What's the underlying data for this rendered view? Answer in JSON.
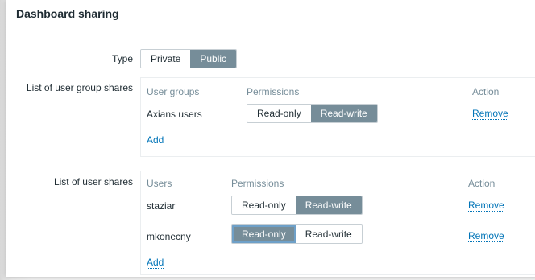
{
  "dialog": {
    "title": "Dashboard sharing"
  },
  "type_field": {
    "label": "Type",
    "options": [
      "Private",
      "Public"
    ],
    "selected": "Public"
  },
  "group_shares": {
    "label": "List of user group shares",
    "columns": {
      "name": "User groups",
      "permissions": "Permissions",
      "action": "Action"
    },
    "rows": [
      {
        "name": "Axians users",
        "permission_options": [
          "Read-only",
          "Read-write"
        ],
        "selected": "Read-write",
        "action": "Remove"
      }
    ],
    "add_label": "Add"
  },
  "user_shares": {
    "label": "List of user shares",
    "columns": {
      "name": "Users",
      "permissions": "Permissions",
      "action": "Action"
    },
    "rows": [
      {
        "name": "staziar",
        "permission_options": [
          "Read-only",
          "Read-write"
        ],
        "selected": "Read-write",
        "action": "Remove"
      },
      {
        "name": "mkonecny",
        "permission_options": [
          "Read-only",
          "Read-write"
        ],
        "selected": "Read-only",
        "action": "Remove"
      }
    ],
    "add_label": "Add"
  },
  "colors": {
    "accent": "#768d99",
    "link": "#0275b8",
    "text": "#1f2c33",
    "muted": "#768d99"
  }
}
